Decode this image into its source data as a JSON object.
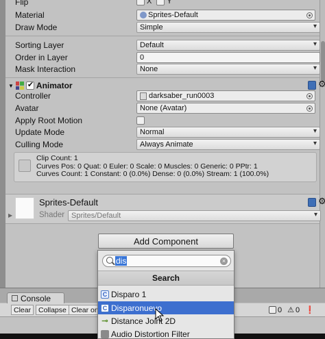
{
  "inspector": {
    "flip": {
      "label": "Flip",
      "x": "X",
      "y": "Y"
    },
    "material": {
      "label": "Material",
      "value": "Sprites-Default"
    },
    "draw_mode": {
      "label": "Draw Mode",
      "value": "Simple"
    },
    "sorting_layer": {
      "label": "Sorting Layer",
      "value": "Default"
    },
    "order_in_layer": {
      "label": "Order in Layer",
      "value": "0"
    },
    "mask_interaction": {
      "label": "Mask Interaction",
      "value": "None"
    }
  },
  "animator": {
    "title": "Animator",
    "controller": {
      "label": "Controller",
      "value": "darksaber_run0003"
    },
    "avatar": {
      "label": "Avatar",
      "value": "None (Avatar)"
    },
    "apply_root_motion": {
      "label": "Apply Root Motion"
    },
    "update_mode": {
      "label": "Update Mode",
      "value": "Normal"
    },
    "culling_mode": {
      "label": "Culling Mode",
      "value": "Always Animate"
    },
    "info": {
      "line1": "Clip Count: 1",
      "line2": "Curves Pos: 0 Quat: 0 Euler: 0 Scale: 0 Muscles: 0 Generic: 0 PPtr: 1",
      "line3": "Curves Count: 1 Constant: 0 (0.0%) Dense: 0 (0.0%) Stream: 1 (100.0%)"
    }
  },
  "material_panel": {
    "name": "Sprites-Default",
    "shader_label": "Shader",
    "shader_value": "Sprites/Default"
  },
  "add_component": {
    "button_label": "Add Component",
    "search_value": "dis",
    "header": "Search",
    "results": [
      {
        "label": "Disparo 1",
        "highlighted": false
      },
      {
        "label": "Disparonuevo",
        "highlighted": true
      },
      {
        "label": "Distance Joint 2D",
        "highlighted": false
      },
      {
        "label": "Audio Distortion Filter",
        "highlighted": false
      }
    ]
  },
  "console": {
    "tab_label": "Console",
    "buttons": {
      "clear": "Clear",
      "collapse": "Collapse",
      "clear_on_play": "Clear on"
    },
    "counts": {
      "warnings": "0",
      "errors": "0"
    }
  },
  "colors": {
    "highlight": "#3d6fcf",
    "panel": "#c2c2c2"
  }
}
